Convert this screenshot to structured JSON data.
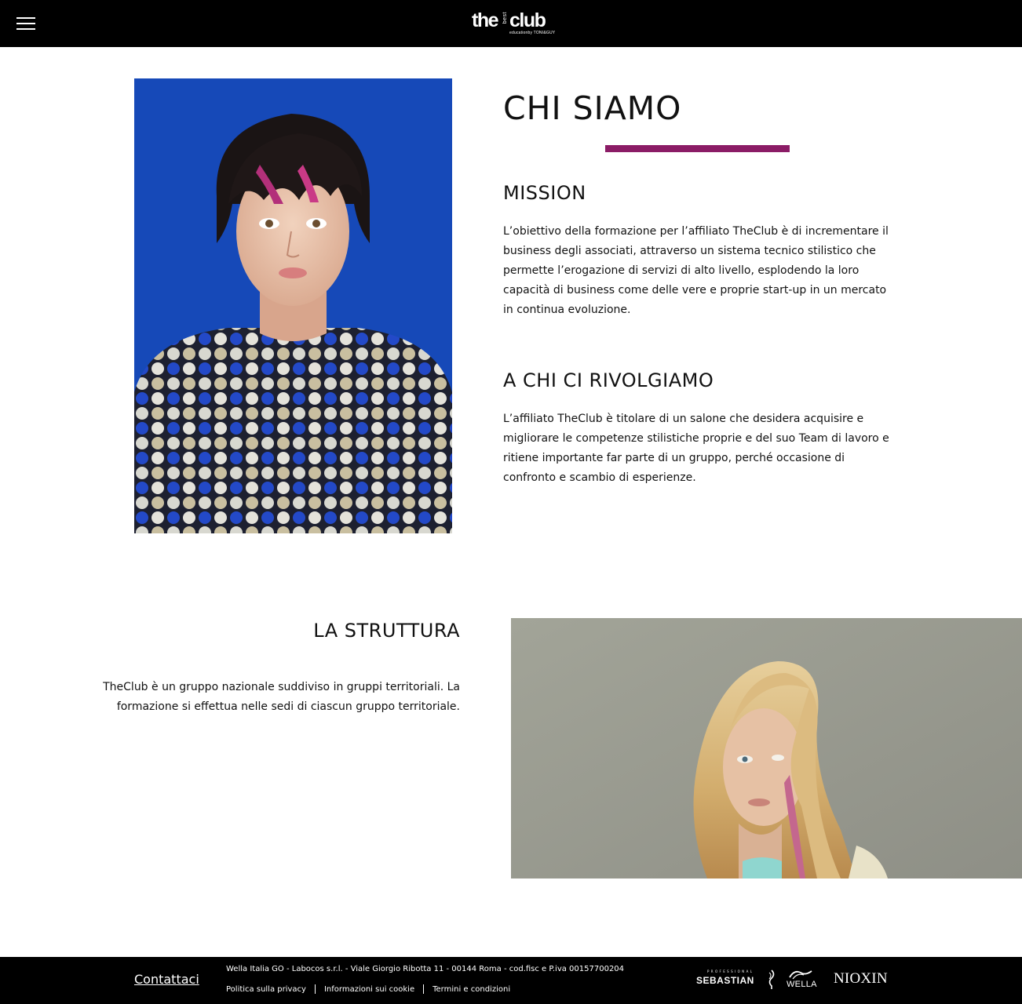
{
  "header": {
    "menu_icon": "hamburger-menu-icon",
    "logo": {
      "the": "the",
      "best": "best",
      "club": "club",
      "tagline": "educationby TONI&GUY"
    }
  },
  "about": {
    "title": "CHI SIAMO",
    "accent_color": "#8b1c66",
    "mission": {
      "heading": "MISSION",
      "text": "L’obiettivo della formazione per l’affiliato TheClub è di incrementare il business degli associati, attraverso un sistema tecnico stilistico che permette l’erogazione di servizi di alto livello, esplodendo la loro capacità di business come delle vere e proprie start-up in un mercato in continua evoluzione."
    },
    "audience": {
      "heading": "A CHI CI RIVOLGIAMO",
      "text": "L’affiliato TheClub è titolare di un salone che desidera acquisire e migliorare le competenze stilistiche proprie e del suo Team di lavoro e ritiene importante far parte di un gruppo, perché occasione di confronto e scambio di esperienze."
    }
  },
  "structure": {
    "heading": "LA STRUTTURA",
    "text": "TheClub è un gruppo nazionale suddiviso in gruppi territoriali. La formazione si effettua nelle sedi di ciascun gruppo territoriale."
  },
  "footer": {
    "contact": "Contattaci",
    "address": "Wella Italia GO - Labocos s.r.l. - Viale Giorgio Ribotta 11 - 00144 Roma - cod.fisc e P.iva 00157700204",
    "links": [
      "Politica sulla privacy",
      "Informazioni sui cookie",
      "Termini e condizioni"
    ],
    "brands": {
      "sebastian_pro": "PROFESSIONAL",
      "sebastian": "SEBASTIAN",
      "wella": "WELLA",
      "nioxin": "NIOXIN"
    }
  }
}
